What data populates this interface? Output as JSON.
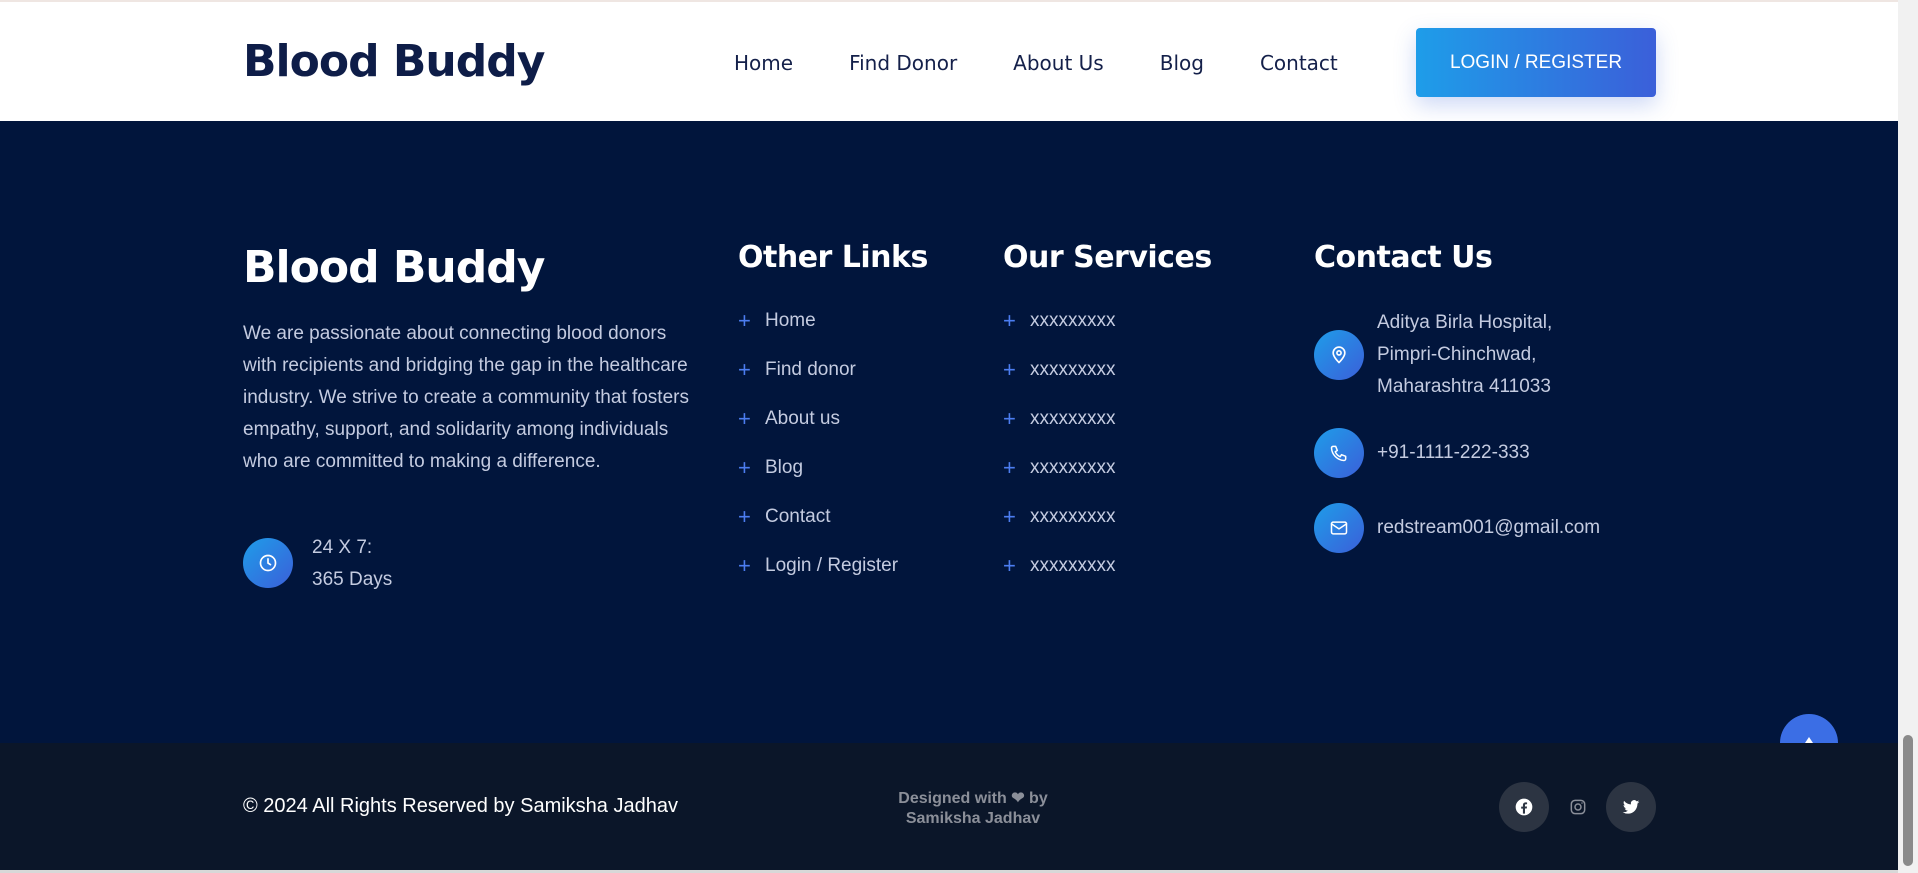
{
  "header": {
    "brand": "Blood Buddy",
    "nav": [
      "Home",
      "Find Donor",
      "About Us",
      "Blog",
      "Contact"
    ],
    "login_button": "LOGIN / REGISTER"
  },
  "footer": {
    "brand": "Blood Buddy",
    "about": "We are passionate about connecting blood donors with recipients and bridging the gap in the healthcare industry. We strive to create a community that fosters empathy, support, and solidarity among individuals who are committed to making a difference.",
    "hours": {
      "line1": "24 X 7:",
      "line2": "365 Days",
      "icon": "clock-icon"
    },
    "other_links": {
      "title": "Other Links",
      "items": [
        "Home",
        "Find donor",
        "About us",
        "Blog",
        "Contact",
        "Login / Register"
      ]
    },
    "services": {
      "title": "Our Services",
      "items": [
        "xxxxxxxxx",
        "xxxxxxxxx",
        "xxxxxxxxx",
        "xxxxxxxxx",
        "xxxxxxxxx",
        "xxxxxxxxx"
      ]
    },
    "contact": {
      "title": "Contact Us",
      "address": [
        "Aditya Birla Hospital,",
        "Pimpri-Chinchwad,",
        "Maharashtra 411033"
      ],
      "phone": "+91-1111-222-333",
      "email": "redstream001@gmail.com"
    },
    "copyright": "© 2024 All Rights Reserved by Samiksha Jadhav",
    "designed_by": {
      "prefix": "Designed with",
      "heart": "❤",
      "suffix": "by",
      "name": "Samiksha Jadhav"
    },
    "social": [
      "facebook-icon",
      "instagram-icon",
      "twitter-icon"
    ]
  },
  "colors": {
    "brand_dark": "#0e1d48",
    "footer_bg": "#01153c",
    "footer_bottom_bg": "#0b1629",
    "accent_gradient_start": "#1e9de9",
    "accent_gradient_end": "#3b5fd9",
    "plus_accent": "#4c7df0"
  }
}
